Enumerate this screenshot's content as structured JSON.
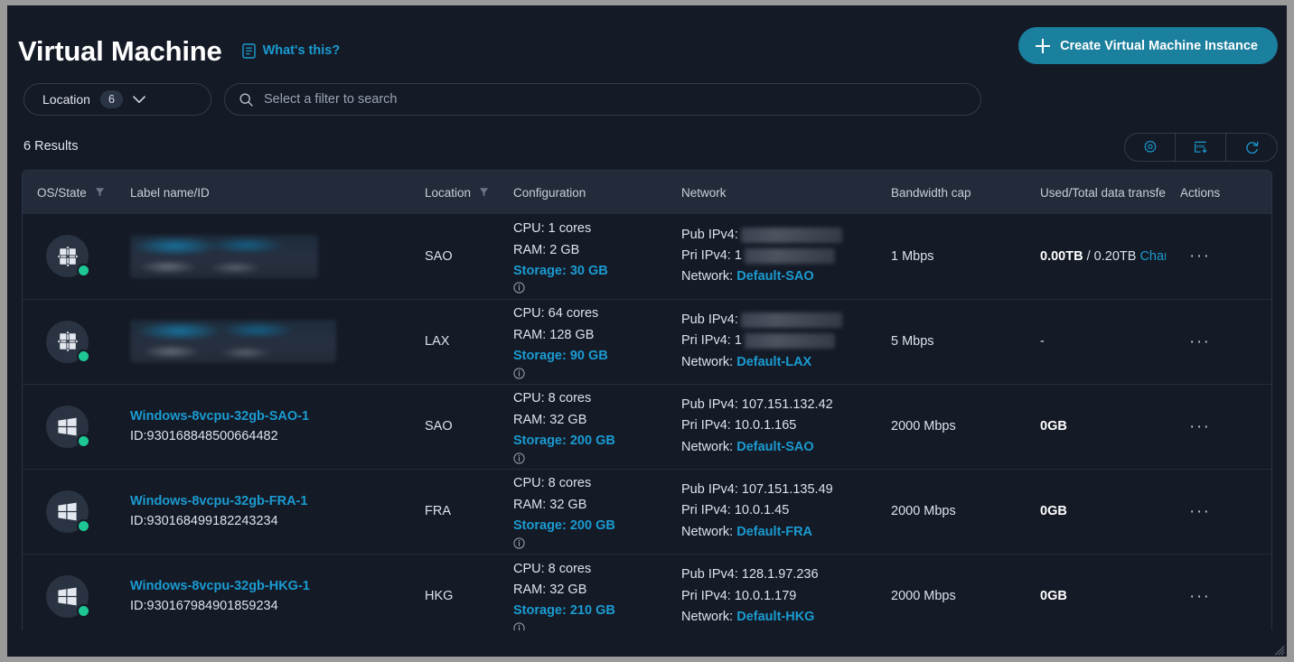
{
  "header": {
    "title": "Virtual Machine",
    "whats_this": "What's this?",
    "doc_icon": "document-icon",
    "create_button": "Create Virtual Machine Instance",
    "plus_icon": "plus-icon"
  },
  "filters": {
    "location_label": "Location",
    "location_count": "6",
    "chevron_icon": "chevron-down-icon",
    "search_placeholder": "Select a filter to search",
    "search_value": "",
    "search_icon": "search-icon"
  },
  "toolbar": {
    "results_text": "6 Results",
    "icons": [
      {
        "name": "settings-gear-icon",
        "title": "Settings"
      },
      {
        "name": "csv-download-icon",
        "title": "Download CSV"
      },
      {
        "name": "refresh-icon",
        "title": "Refresh"
      }
    ]
  },
  "table": {
    "columns": [
      {
        "key": "os",
        "label": "OS/State",
        "filter": true
      },
      {
        "key": "label",
        "label": "Label name/ID",
        "filter": false
      },
      {
        "key": "location",
        "label": "Location",
        "filter": true
      },
      {
        "key": "configuration",
        "label": "Configuration",
        "filter": false
      },
      {
        "key": "network",
        "label": "Network",
        "filter": false
      },
      {
        "key": "bandwidth",
        "label": "Bandwidth cap",
        "filter": false
      },
      {
        "key": "data_transfer",
        "label": "Used/Total data transfer",
        "info": true
      },
      {
        "key": "actions",
        "label": "Actions",
        "filter": false
      }
    ],
    "rows": [
      {
        "os_icon": "linux-os-icon",
        "state": "running",
        "label_redacted": true,
        "label": "",
        "id": "",
        "location": "SAO",
        "cpu": "CPU: 1 cores",
        "ram": "RAM: 2 GB",
        "storage": "Storage: 30 GB",
        "pub_ipv4_label": "Pub IPv4:",
        "pub_ipv4": "",
        "pub_ipv4_redacted": true,
        "pri_ipv4_label": "Pri IPv4:",
        "pri_ipv4": "1",
        "pri_ipv4_redacted": true,
        "network_label": "Network:",
        "network": "Default-SAO",
        "bandwidth": "1 Mbps",
        "data_used": "0.00TB",
        "data_total": "0.20TB",
        "data_change": "Change",
        "actions": "···"
      },
      {
        "os_icon": "linux-os-icon",
        "state": "running",
        "label_redacted": true,
        "label": "",
        "id": "",
        "location": "LAX",
        "cpu": "CPU: 64 cores",
        "ram": "RAM: 128 GB",
        "storage": "Storage: 90 GB",
        "pub_ipv4_label": "Pub IPv4:",
        "pub_ipv4": "",
        "pub_ipv4_redacted": true,
        "pri_ipv4_label": "Pri IPv4:",
        "pri_ipv4": "1",
        "pri_ipv4_redacted": true,
        "network_label": "Network:",
        "network": "Default-LAX",
        "bandwidth": "5 Mbps",
        "data_used": "-",
        "data_total": "",
        "data_change": "",
        "actions": "···"
      },
      {
        "os_icon": "windows-os-icon",
        "state": "running",
        "label_redacted": false,
        "label": "Windows-8vcpu-32gb-SAO-1",
        "id": "ID:930168848500664482",
        "location": "SAO",
        "cpu": "CPU: 8 cores",
        "ram": "RAM: 32 GB",
        "storage": "Storage: 200 GB",
        "pub_ipv4_label": "Pub IPv4:",
        "pub_ipv4": "107.151.132.42",
        "pub_ipv4_redacted": false,
        "pri_ipv4_label": "Pri IPv4:",
        "pri_ipv4": "10.0.1.165",
        "pri_ipv4_redacted": false,
        "network_label": "Network:",
        "network": "Default-SAO",
        "bandwidth": "2000 Mbps",
        "data_used": "0GB",
        "data_total": "",
        "data_change": "",
        "actions": "···"
      },
      {
        "os_icon": "windows-os-icon",
        "state": "running",
        "label_redacted": false,
        "label": "Windows-8vcpu-32gb-FRA-1",
        "id": "ID:930168499182243234",
        "location": "FRA",
        "cpu": "CPU: 8 cores",
        "ram": "RAM: 32 GB",
        "storage": "Storage: 200 GB",
        "pub_ipv4_label": "Pub IPv4:",
        "pub_ipv4": "107.151.135.49",
        "pub_ipv4_redacted": false,
        "pri_ipv4_label": "Pri IPv4:",
        "pri_ipv4": "10.0.1.45",
        "pri_ipv4_redacted": false,
        "network_label": "Network:",
        "network": "Default-FRA",
        "bandwidth": "2000 Mbps",
        "data_used": "0GB",
        "data_total": "",
        "data_change": "",
        "actions": "···"
      },
      {
        "os_icon": "windows-os-icon",
        "state": "running",
        "label_redacted": false,
        "label": "Windows-8vcpu-32gb-HKG-1",
        "id": "ID:930167984901859234",
        "location": "HKG",
        "cpu": "CPU: 8 cores",
        "ram": "RAM: 32 GB",
        "storage": "Storage: 210 GB",
        "pub_ipv4_label": "Pub IPv4:",
        "pub_ipv4": "128.1.97.236",
        "pub_ipv4_redacted": false,
        "pri_ipv4_label": "Pri IPv4:",
        "pri_ipv4": "10.0.1.179",
        "pri_ipv4_redacted": false,
        "network_label": "Network:",
        "network": "Default-HKG",
        "bandwidth": "2000 Mbps",
        "data_used": "0GB",
        "data_total": "",
        "data_change": "",
        "actions": "···"
      }
    ]
  },
  "colors": {
    "accent_link": "#1b9bd1",
    "primary_button": "#1b7f9e",
    "status_running": "#1ec894",
    "page_bg": "#141a26",
    "header_row_bg": "#222b3a"
  }
}
